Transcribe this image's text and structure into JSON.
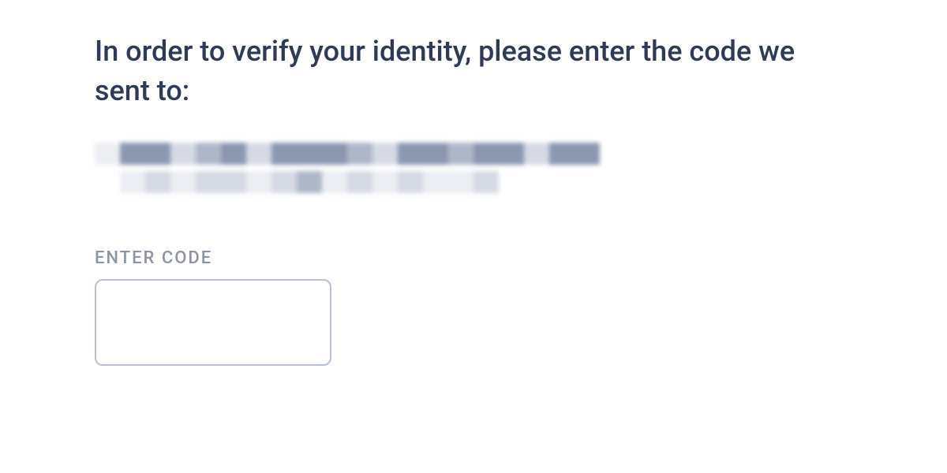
{
  "verify": {
    "instruction": "In order to verify your identity, please enter the code we sent to:",
    "destination_redacted": true,
    "code_label": "ENTER CODE",
    "code_value": ""
  }
}
